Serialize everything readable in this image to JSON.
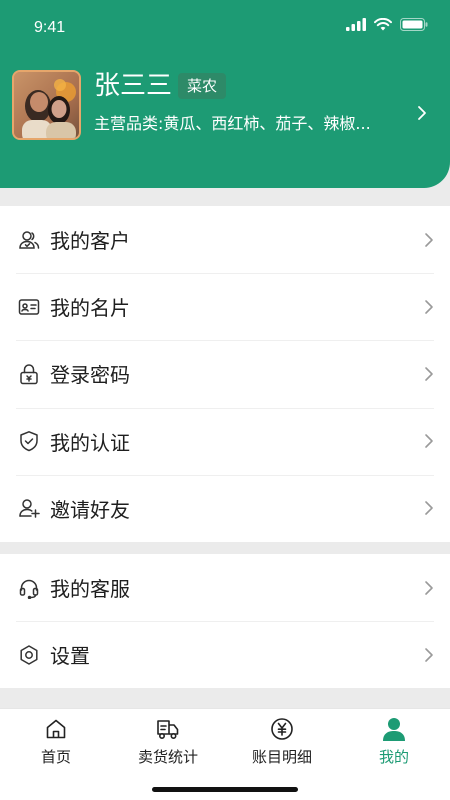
{
  "status_bar": {
    "time": "9:41"
  },
  "profile": {
    "name": "张三三",
    "role": "菜农",
    "categories": "主营品类:黄瓜、西红柿、茄子、辣椒..."
  },
  "menu_group_1": [
    {
      "label": "我的客户",
      "icon": "customers-icon"
    },
    {
      "label": "我的名片",
      "icon": "business-card-icon"
    },
    {
      "label": "登录密码",
      "icon": "lock-icon"
    },
    {
      "label": "我的认证",
      "icon": "shield-check-icon"
    },
    {
      "label": "邀请好友",
      "icon": "add-user-icon"
    }
  ],
  "menu_group_2": [
    {
      "label": "我的客服",
      "icon": "headset-icon"
    },
    {
      "label": "设置",
      "icon": "settings-icon"
    }
  ],
  "tabbar": [
    {
      "label": "首页",
      "icon": "home-icon",
      "active": false
    },
    {
      "label": "卖货统计",
      "icon": "truck-icon",
      "active": false
    },
    {
      "label": "账目明细",
      "icon": "yen-icon",
      "active": false
    },
    {
      "label": "我的",
      "icon": "user-icon",
      "active": true
    }
  ],
  "colors": {
    "brand_green": "#1d9b74",
    "badge_green": "#2d8a68"
  }
}
